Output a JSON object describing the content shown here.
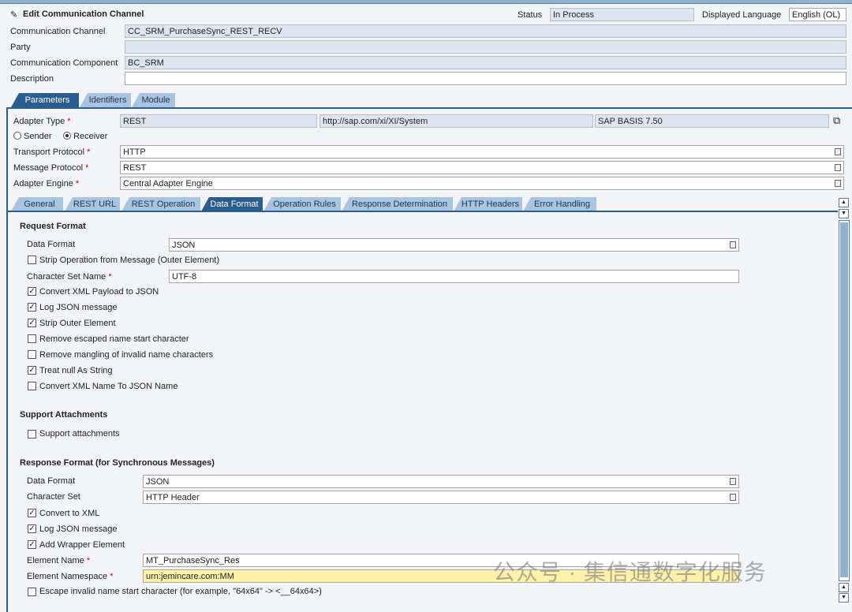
{
  "header": {
    "title": "Edit Communication Channel",
    "status_label": "Status",
    "status_value": "In Process",
    "language_label": "Displayed Language",
    "language_value": "English (OL)"
  },
  "fields": {
    "channel_label": "Communication Channel",
    "channel_value": "CC_SRM_PurchaseSync_REST_RECV",
    "party_label": "Party",
    "party_value": "",
    "component_label": "Communication Component",
    "component_value": "BC_SRM",
    "description_label": "Description",
    "description_value": ""
  },
  "main_tabs": [
    "Parameters",
    "Identifiers",
    "Module"
  ],
  "adapter": {
    "type_label": "Adapter Type",
    "type_value": "REST",
    "namespace": "http://sap.com/xi/XI/System",
    "version": "SAP BASIS 7.50",
    "sender": "Sender",
    "receiver": "Receiver",
    "transport_label": "Transport Protocol",
    "transport_value": "HTTP",
    "message_label": "Message Protocol",
    "message_value": "REST",
    "engine_label": "Adapter Engine",
    "engine_value": "Central Adapter Engine"
  },
  "sub_tabs": [
    "General",
    "REST URL",
    "REST Operation",
    "Data Format",
    "Operation Rules",
    "Response Determination",
    "HTTP Headers",
    "Error Handling"
  ],
  "request": {
    "heading": "Request Format",
    "data_format_label": "Data Format",
    "data_format_value": "JSON",
    "strip_op": "Strip Operation from Message (Outer Element)",
    "charset_label": "Character Set Name",
    "charset_value": "UTF-8",
    "checks": [
      {
        "label": "Convert XML Payload to JSON",
        "checked": true
      },
      {
        "label": "Log JSON message",
        "checked": true
      },
      {
        "label": "Strip Outer Element",
        "checked": true
      },
      {
        "label": "Remove escaped name start character",
        "checked": false
      },
      {
        "label": "Remove mangling of invalid name characters",
        "checked": false
      },
      {
        "label": "Treat null As String",
        "checked": true
      },
      {
        "label": "Convert XML Name To JSON Name",
        "checked": false
      }
    ]
  },
  "attachments": {
    "heading": "Support Attachments",
    "label": "Support attachments"
  },
  "response": {
    "heading": "Response Format (for Synchronous Messages)",
    "data_format_label": "Data Format",
    "data_format_value": "JSON",
    "charset_label": "Character Set",
    "charset_value": "HTTP Header",
    "checks": [
      {
        "label": "Convert to XML",
        "checked": true
      },
      {
        "label": "Log JSON message",
        "checked": true
      },
      {
        "label": "Add Wrapper Element",
        "checked": true
      }
    ],
    "element_name_label": "Element Name",
    "element_name_value": "MT_PurchaseSync_Res",
    "element_ns_label": "Element Namespace",
    "element_ns_value": "urn:jemincare.com:MM",
    "escape_label": "Escape invalid name start character (for example, \"64x64\" -> <__64x64>)"
  },
  "watermark": "公众号 · 集信通数字化服务"
}
